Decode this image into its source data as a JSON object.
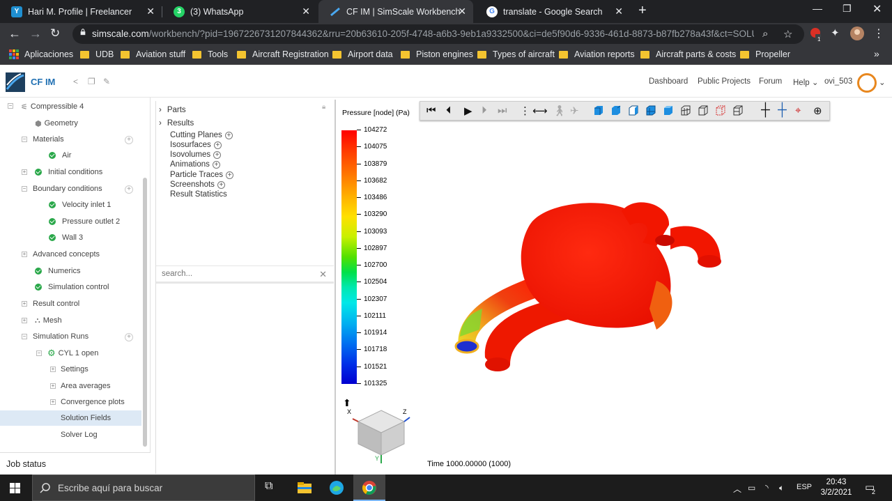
{
  "browser": {
    "tabs": [
      {
        "label": "Hari M. Profile | Freelancer",
        "icon": "freelancer-icon"
      },
      {
        "label": "(3) WhatsApp",
        "icon": "whatsapp-icon",
        "badge": "3"
      },
      {
        "label": "CF IM | SimScale Workbench",
        "icon": "simscale-icon"
      },
      {
        "label": "translate - Google Search",
        "icon": "google-icon"
      }
    ],
    "url_host": "simscale.com",
    "url_rest": "/workbench/?pid=1967226731207844362&rru=20b63610-205f-4748-a6b3-9eb1a9332500&ci=de5f90d6-9336-461d-8873-b87fb278a43f&ct=SOLUT...",
    "extension_badge": "1",
    "bookmarks": [
      "Aplicaciones",
      "UDB",
      "Aviation stuff",
      "Tools",
      "Aircraft Registration",
      "Airport data",
      "Piston engines",
      "Types of aircraft",
      "Aviation reports",
      "Aircraft parts & costs",
      "Propeller"
    ]
  },
  "app": {
    "name": "CF IM",
    "nav": {
      "dashboard": "Dashboard",
      "public_projects": "Public Projects",
      "forum": "Forum",
      "help": "Help",
      "user": "ovi_503"
    }
  },
  "tree": {
    "items": [
      {
        "label": "Compressible 4"
      },
      {
        "label": "Geometry"
      },
      {
        "label": "Materials"
      },
      {
        "label": "Air"
      },
      {
        "label": "Initial conditions"
      },
      {
        "label": "Boundary conditions"
      },
      {
        "label": "Velocity inlet 1"
      },
      {
        "label": "Pressure outlet 2"
      },
      {
        "label": "Wall 3"
      },
      {
        "label": "Advanced concepts"
      },
      {
        "label": "Numerics"
      },
      {
        "label": "Simulation control"
      },
      {
        "label": "Result control"
      },
      {
        "label": "Mesh"
      },
      {
        "label": "Simulation Runs"
      },
      {
        "label": "CYL 1 open"
      },
      {
        "label": "Settings"
      },
      {
        "label": "Area averages"
      },
      {
        "label": "Convergence plots"
      },
      {
        "label": "Solution Fields"
      },
      {
        "label": "Solver Log"
      }
    ],
    "job_status": "Job status"
  },
  "filters": {
    "items": [
      "Parts",
      "Results",
      "Cutting Planes",
      "Isosurfaces",
      "Isovolumes",
      "Animations",
      "Particle Traces",
      "Screenshots",
      "Result Statistics"
    ],
    "search_placeholder": "search..."
  },
  "viewer": {
    "legend_title": "Pressure [node] (Pa)",
    "legend_ticks": [
      "104272",
      "104075",
      "103879",
      "103682",
      "103486",
      "103290",
      "103093",
      "102897",
      "102700",
      "102504",
      "102307",
      "102111",
      "101914",
      "101718",
      "101521",
      "101325"
    ],
    "time_label": "Time 1000.00000 (1000)",
    "axis_labels": {
      "x": "X",
      "y": "Y",
      "z": "Z"
    },
    "colors": {
      "high": "#ff0000",
      "low": "#0000d0"
    }
  },
  "taskbar": {
    "search_placeholder": "Escribe aquí para buscar",
    "language": "ESP",
    "time": "20:43",
    "date": "3/2/2021",
    "notifications": "2"
  }
}
